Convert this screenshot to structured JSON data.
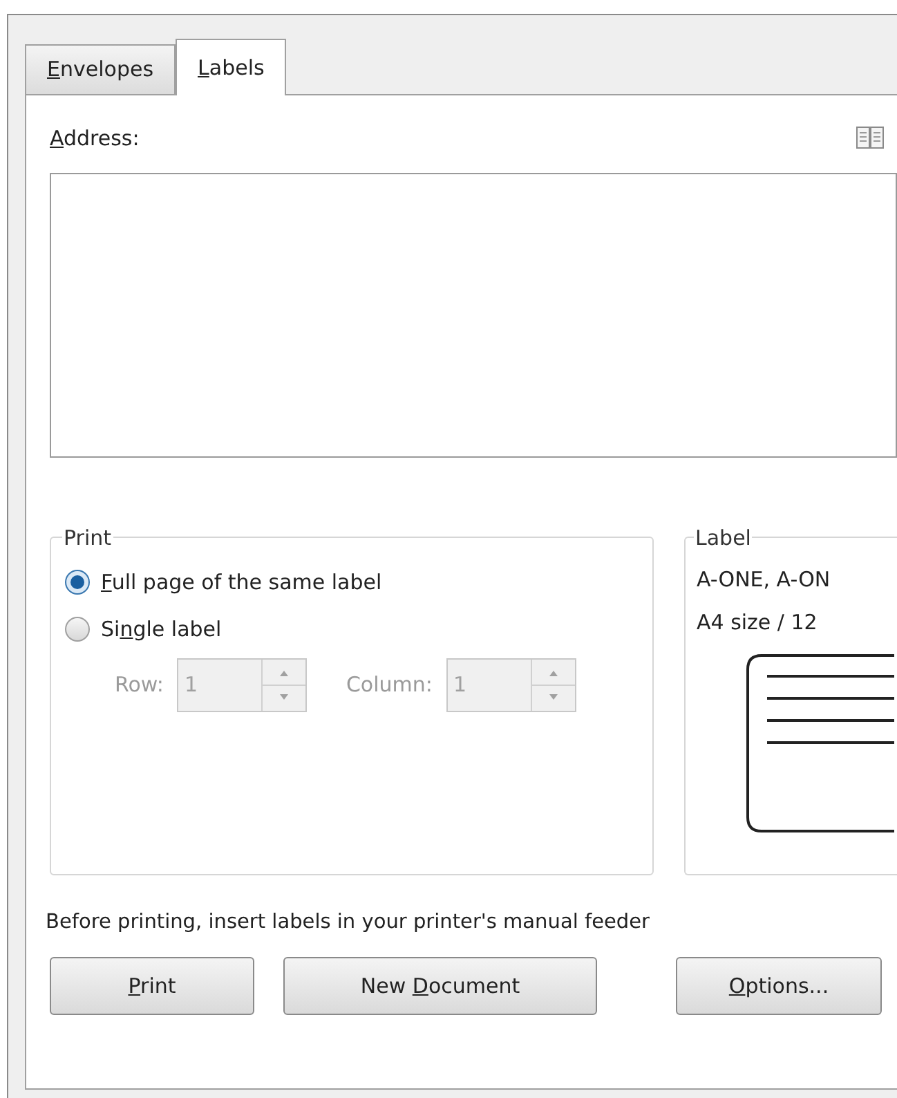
{
  "tabs": [
    {
      "label": [
        {
          "text": "E",
          "underlined": true
        },
        {
          "text": "nvelopes",
          "underlined": false
        }
      ],
      "selected": false
    },
    {
      "label": [
        {
          "text": "L",
          "underlined": true
        },
        {
          "text": "abels",
          "underlined": false
        }
      ],
      "selected": true
    }
  ],
  "address": {
    "label": [
      {
        "text": "A",
        "underlined": true
      },
      {
        "text": "ddress:",
        "underlined": false
      }
    ]
  },
  "print_group": {
    "title": "Print",
    "options": [
      {
        "label": [
          {
            "text": "F",
            "underlined": true
          },
          {
            "text": "ull page of the same label",
            "underlined": false
          }
        ],
        "selected": true
      },
      {
        "label": [
          {
            "text": "Si",
            "underlined": false
          },
          {
            "text": "n",
            "underlined": true
          },
          {
            "text": "gle label",
            "underlined": false
          }
        ],
        "selected": false
      }
    ],
    "row": {
      "label": "Row:",
      "value": "1",
      "disabled": true
    },
    "column": {
      "label": "Column:",
      "value": "1",
      "disabled": true
    }
  },
  "label_group": {
    "title": "Label",
    "lines": [
      "A-ONE, A-ON",
      "A4 size / 12"
    ]
  },
  "note": "Before printing, insert labels in your printer's manual feeder",
  "buttons": [
    {
      "label": [
        {
          "text": "P",
          "underlined": true
        },
        {
          "text": "rint",
          "underlined": false
        }
      ]
    },
    {
      "label": [
        {
          "text": "New ",
          "underlined": false
        },
        {
          "text": "D",
          "underlined": true
        },
        {
          "text": "ocument",
          "underlined": false
        }
      ]
    },
    {
      "label": [
        {
          "text": "O",
          "underlined": true
        },
        {
          "text": "ptions...",
          "underlined": false
        }
      ]
    }
  ]
}
